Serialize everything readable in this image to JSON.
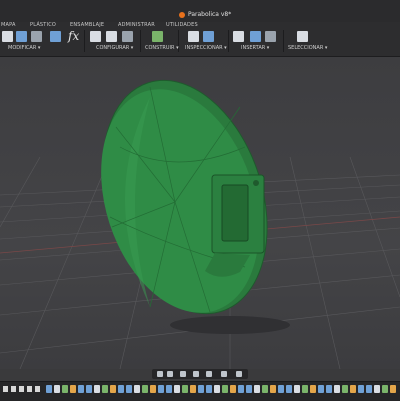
{
  "title_bar": {
    "document_title": "Parabolica v8*"
  },
  "tabs": [
    {
      "label": "MAPA"
    },
    {
      "label": "PLÁSTICO"
    },
    {
      "label": "ENSAMBLAJE"
    },
    {
      "label": "ADMINISTRAR"
    },
    {
      "label": "UTILIDADES"
    }
  ],
  "ribbon": {
    "groups": [
      {
        "label": "MODIFICAR ▾"
      },
      {
        "label": "CONFIGURAR ▾"
      },
      {
        "label": "CONSTRUIR ▾"
      },
      {
        "label": "INSPECCIONAR ▾"
      },
      {
        "label": "INSERTAR ▾"
      },
      {
        "label": "SELECCIONAR ▾"
      }
    ],
    "function_icon": "fx"
  },
  "viewport": {
    "model": "green-parabolic-dish",
    "model_color": "#2f8c46",
    "grid_color": "#5b5b5e"
  },
  "navigation_bar": {
    "icons": [
      "orbit-icon",
      "pan-icon",
      "zoom-icon",
      "fit-icon",
      "display-icon",
      "grid-icon",
      "viewport-icon"
    ]
  },
  "timeline": {
    "controls": [
      "first-icon",
      "previous-icon",
      "play-icon",
      "next-icon",
      "last-icon"
    ],
    "feature_colors": [
      "#6fa0d6",
      "#d9dde3",
      "#7ab46a",
      "#e3a54a",
      "#6fa0d6"
    ]
  }
}
